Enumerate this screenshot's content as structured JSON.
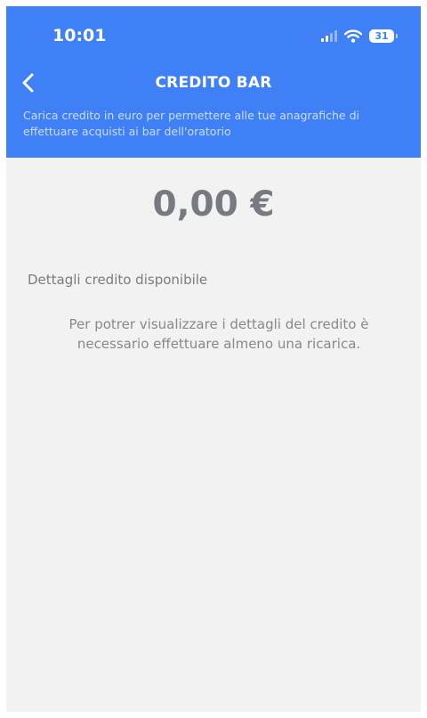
{
  "status_bar": {
    "time": "10:01",
    "battery": "31"
  },
  "header": {
    "title": "CREDITO BAR",
    "subtitle": "Carica credito in euro per permettere alle tue anagrafiche di effettuare acquisti ai bar dell'oratorio",
    "back_icon": "chevron-left-icon"
  },
  "main": {
    "credit_amount": "0,00 €",
    "details_label": "Dettagli credito disponibile",
    "empty_message": "Per potrer visualizzare i dettagli del credito è necessario effettuare almeno una ricarica."
  },
  "colors": {
    "header_bg": "#4080f6",
    "page_bg": "#f2f2f2",
    "amount_text": "#777a80",
    "body_text": "#888888"
  }
}
